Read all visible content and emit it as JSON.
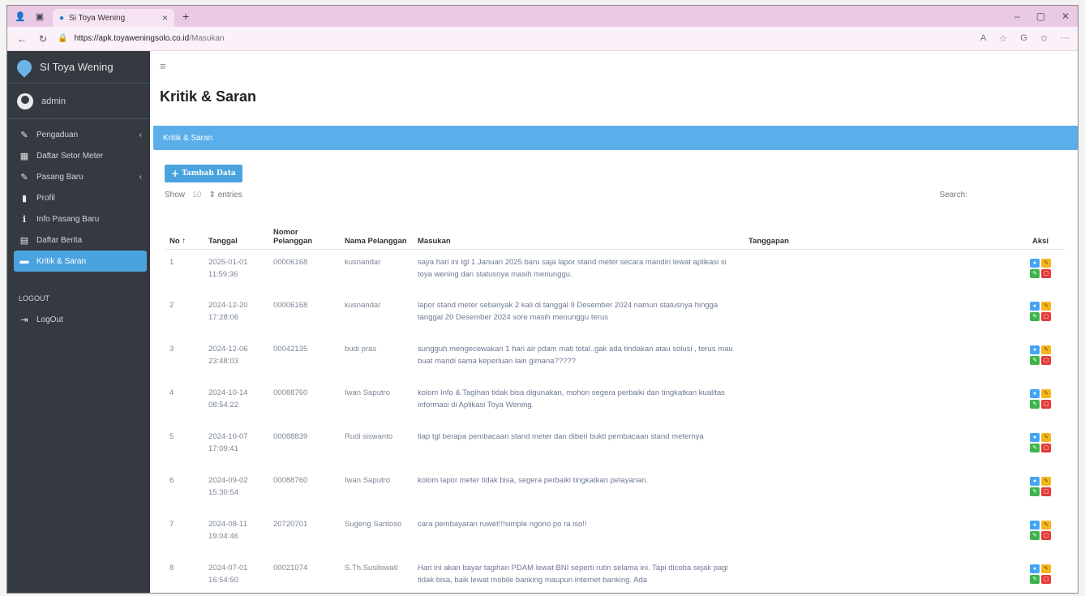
{
  "browser": {
    "tab_title": "Si Toya Wening",
    "new_tab": "+",
    "close": "×",
    "url_host": "https://apk.toyaweningsolo.co.id",
    "url_path": "/Masukan"
  },
  "sidebar": {
    "brand": "SI Toya Wening",
    "user": "admin",
    "items": [
      {
        "label": "Pengaduan",
        "icon": "edit-icon",
        "chev": "‹"
      },
      {
        "label": "Daftar Setor Meter",
        "icon": "calculator-icon",
        "chev": ""
      },
      {
        "label": "Pasang Baru",
        "icon": "edit-icon",
        "chev": "‹"
      },
      {
        "label": "Profil",
        "icon": "building-icon",
        "chev": ""
      },
      {
        "label": "Info Pasang Baru",
        "icon": "info-icon",
        "chev": ""
      },
      {
        "label": "Daftar Berita",
        "icon": "newspaper-icon",
        "chev": ""
      },
      {
        "label": "Kritik & Saran",
        "icon": "card-icon",
        "chev": ""
      }
    ],
    "section_logout": "LOGOUT",
    "logout": "LogOut"
  },
  "main": {
    "title": "Kritik & Saran",
    "card_title": "Kritik & Saran",
    "add_button": "Tambah Data",
    "show_label": "Show",
    "show_value": "10",
    "entries_label": "entries",
    "search_label": "Search:"
  },
  "table": {
    "headers": {
      "no": "No",
      "tanggal": "Tanggal",
      "nomor": "Nomor Pelanggan",
      "nama": "Nama Pelanggan",
      "masukan": "Masukan",
      "tanggapan": "Tanggapan",
      "aksi": "Aksi"
    },
    "rows": [
      {
        "no": "1",
        "tanggal": "2025-01-01 11:59:36",
        "nomor": "00006168",
        "nama": "kusnandar",
        "masukan": "saya hari ini tgl 1 Januari 2025 baru saja lapor stand meter secara mandiri lewat aplikasi si toya wening dan statusnya masih menunggu."
      },
      {
        "no": "2",
        "tanggal": "2024-12-20 17:28:06",
        "nomor": "00006168",
        "nama": "kusnandar",
        "masukan": "lapor stand meter sebanyak 2 kali di tanggal 9 Desember 2024 namun statusnya hingga tanggal 20 Desember 2024 sore masih menunggu terus"
      },
      {
        "no": "3",
        "tanggal": "2024-12-06 23:48:03",
        "nomor": "00042135",
        "nama": "budi pras",
        "masukan": "sungguh mengecewakan 1 hari air pdam mati total..gak ada tindakan atau solusi , terus mau buat mandi sama keperluan lain gimana?????"
      },
      {
        "no": "4",
        "tanggal": "2024-10-14 08:54:22",
        "nomor": "00088760",
        "nama": "Iwan Saputro",
        "masukan": "kolom Info & Tagihan tidak bisa digunakan, mohon segera perbaiki dan tingkatkan kualitas informasi di Aplikasi Toya Wening."
      },
      {
        "no": "5",
        "tanggal": "2024-10-07 17:09:41",
        "nomor": "00088839",
        "nama": "Rudi siswanto",
        "masukan": "tiap tgl berapa pembacaan stand meter dan diberi bukti pembacaan stand meternya"
      },
      {
        "no": "6",
        "tanggal": "2024-09-02 15:30:54",
        "nomor": "00088760",
        "nama": "Iwan Saputro",
        "masukan": "kolom lapor meter tidak bisa, segera perbaiki tingkatkan pelayanan."
      },
      {
        "no": "7",
        "tanggal": "2024-08-11 19:04:46",
        "nomor": "20720701",
        "nama": "Sugeng Santoso",
        "masukan": "cara pembayaran ruwet!!!simple ngono po ra iso!!"
      },
      {
        "no": "8",
        "tanggal": "2024-07-01 16:54:50",
        "nomor": "00021074",
        "nama": "S.Th.Susilowati",
        "masukan": "Hari ini akan bayar tagihan PDAM lewat BNI seperti rutin selama ini. Tapi dicoba sejak pagi tidak bisa, baik lewat mobile banking maupun internet banking. Ada"
      }
    ]
  }
}
